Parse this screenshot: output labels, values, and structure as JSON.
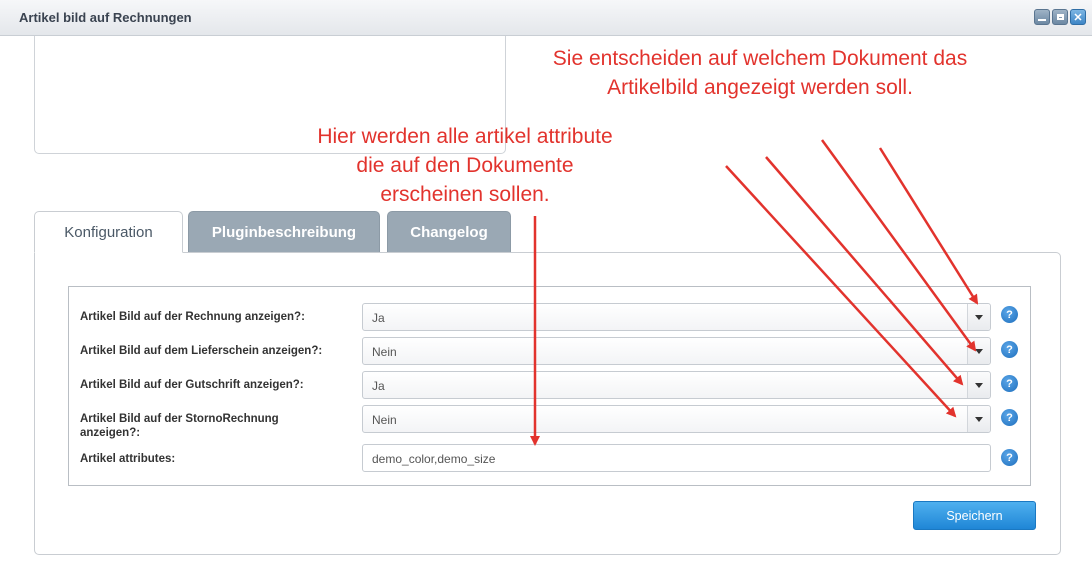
{
  "window": {
    "title": "Artikel bild auf Rechnungen",
    "controls": [
      "minimize-icon",
      "maximize-icon",
      "close-icon"
    ]
  },
  "tabs": [
    {
      "label": "Konfiguration",
      "active": true
    },
    {
      "label": "Pluginbeschreibung",
      "active": false
    },
    {
      "label": "Changelog",
      "active": false
    }
  ],
  "form": {
    "fields": [
      {
        "label": "Artikel Bild auf der Rechnung anzeigen?:",
        "value": "Ja",
        "type": "select"
      },
      {
        "label": "Artikel Bild auf dem Lieferschein anzeigen?:",
        "value": "Nein",
        "type": "select"
      },
      {
        "label": "Artikel Bild auf der Gutschrift anzeigen?:",
        "value": "Ja",
        "type": "select"
      },
      {
        "label": "Artikel Bild auf der StornoRechnung anzeigen?:",
        "value": "Nein",
        "type": "select"
      },
      {
        "label": "Artikel attributes:",
        "value": "demo_color,demo_size",
        "type": "text"
      }
    ],
    "help_icon": "?",
    "save_label": "Speichern"
  },
  "annotations": {
    "document_note": [
      "Sie entscheiden auf welchem Dokument das",
      "Artikelbild angezeigt werden soll."
    ],
    "attributes_note": [
      "Hier werden alle artikel attribute",
      "die auf den Dokumente",
      "erscheinen sollen."
    ]
  },
  "colors": {
    "annotation": "#e2332d",
    "primary_button": "#2a8fdd",
    "inactive_tab": "#9aa8b4"
  }
}
